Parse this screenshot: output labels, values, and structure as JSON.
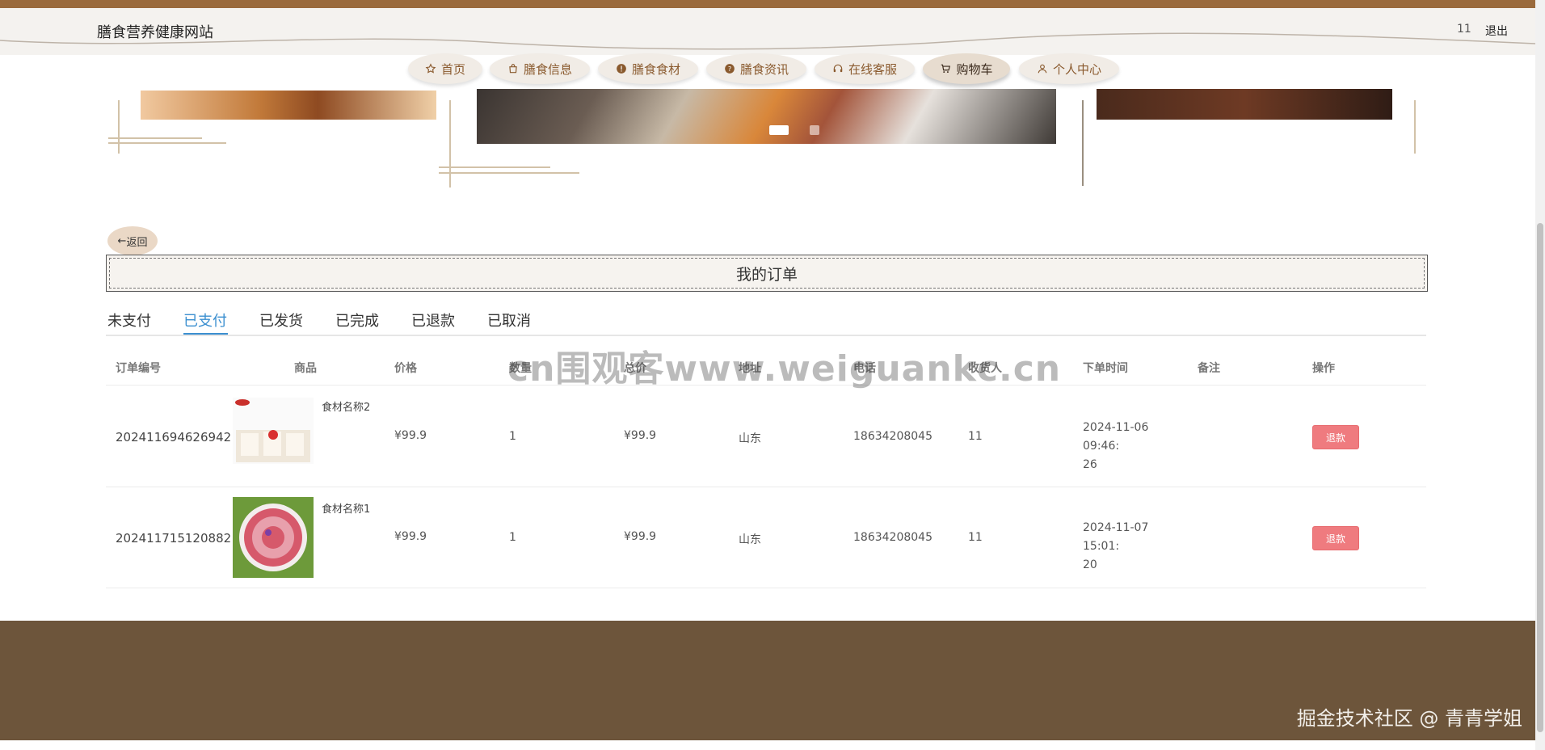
{
  "site": {
    "title": "膳食营养健康网站",
    "user": "11",
    "logout": "退出"
  },
  "nav": {
    "items": [
      {
        "label": "首页",
        "icon": "star-icon"
      },
      {
        "label": "膳食信息",
        "icon": "bag-icon"
      },
      {
        "label": "膳食食材",
        "icon": "alert-circle-icon"
      },
      {
        "label": "膳食资讯",
        "icon": "question-circle-icon"
      },
      {
        "label": "在线客服",
        "icon": "headset-icon"
      },
      {
        "label": "购物车",
        "icon": "cart-icon",
        "active": true
      },
      {
        "label": "个人中心",
        "icon": "user-icon"
      }
    ]
  },
  "page": {
    "back": "返回",
    "title": "我的订单",
    "tabs": [
      "未支付",
      "已支付",
      "已发货",
      "已完成",
      "已退款",
      "已取消"
    ],
    "active_tab": "已支付"
  },
  "table": {
    "headers": [
      "订单编号",
      "商品",
      "价格",
      "数量",
      "总价",
      "地址",
      "电话",
      "收货人",
      "下单时间",
      "备注",
      "操作"
    ],
    "rows": [
      {
        "order_no": "202411694626942",
        "product": "食材名称2",
        "price": "¥99.9",
        "qty": "1",
        "total": "¥99.9",
        "address": "山东",
        "phone": "18634208045",
        "receiver": "11",
        "time_line1": "2024-11-06 09:46:",
        "time_line2": "26",
        "remark": "",
        "action": "退款"
      },
      {
        "order_no": "202411715120882",
        "product": "食材名称1",
        "price": "¥99.9",
        "qty": "1",
        "total": "¥99.9",
        "address": "山东",
        "phone": "18634208045",
        "receiver": "11",
        "time_line1": "2024-11-07 15:01:",
        "time_line2": "20",
        "remark": "",
        "action": "退款"
      }
    ]
  },
  "overlay": {
    "watermark": "cn围观客www.weiguankc.cn",
    "footer_mark": "掘金技术社区 @ 青青学姐"
  },
  "colors": {
    "brand": "#9a6a3c",
    "footer": "#6d553b",
    "tab_active": "#3b8fd0",
    "refund": "#ef7b7f"
  }
}
